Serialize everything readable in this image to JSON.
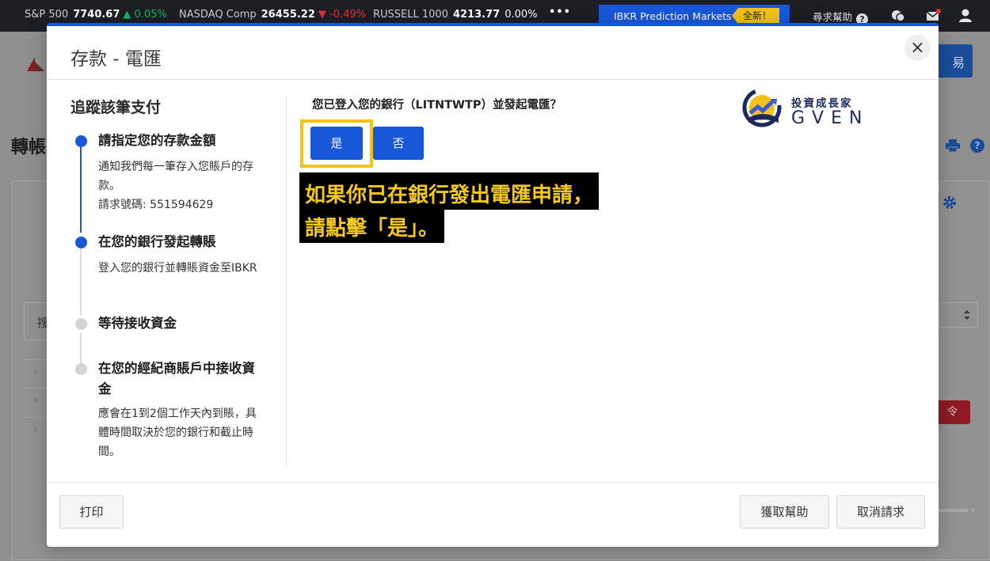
{
  "ticker": {
    "items": [
      {
        "name": "S&P 500",
        "price": "7740.67",
        "change": "▲ 0.05%",
        "direction": "up"
      },
      {
        "name": "NASDAQ Comp",
        "price": "26455.22",
        "change": "▼ -0.49%",
        "direction": "down"
      },
      {
        "name": "RUSSELL 1000",
        "price": "4213.77",
        "change": "0.00%",
        "direction": "flat"
      }
    ],
    "more": "•••",
    "promo_label": "IBKR Prediction Markets",
    "promo_badge": "全新！",
    "help_label": "尋求幫助"
  },
  "background": {
    "page_title": "轉帳",
    "trade_button": "易",
    "search_placeholder": "搜",
    "order_button": "令"
  },
  "modal": {
    "title": "存款 - 電匯",
    "close_glyph": "×",
    "tracker_title": "追蹤該筆支付",
    "steps": [
      {
        "title": "請指定您的存款金額",
        "desc": "通知我們每一筆存入您賬戶的存款。",
        "extra": "請求號碼: 551594629",
        "status": "done"
      },
      {
        "title": "在您的銀行發起轉賬",
        "desc": "登入您的銀行並轉賬資金至IBKR",
        "status": "current"
      },
      {
        "title": "等待接收資金",
        "status": "pending"
      },
      {
        "title": "在您的經紀商賬戶中接收資金",
        "desc": "應會在1到2個工作天內到賬，具體時間取決於您的銀行和截止時間。",
        "status": "pending"
      }
    ],
    "question": "您已登入您的銀行（LITNTWTP）並發起電匯？",
    "yes_label": "是",
    "no_label": "否",
    "annotation_line1": "如果你已在銀行發出電匯申請，",
    "annotation_line2": "請點擊「是」。",
    "watermark_line1": "投資成長家",
    "watermark_line2": "GVEN",
    "footer": {
      "print_label": "打印",
      "help_label": "獲取幫助",
      "cancel_label": "取消請求"
    }
  },
  "colors": {
    "accent": "#1857d8",
    "highlight": "#f2c31a",
    "annotation_text": "#f4c81e",
    "up": "#19b35a",
    "down": "#e0303a"
  }
}
